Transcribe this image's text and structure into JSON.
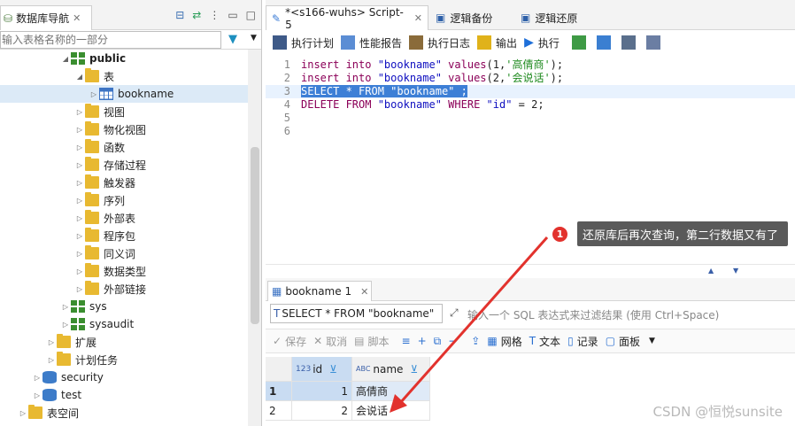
{
  "left_panel": {
    "tab_title": "数据库导航",
    "filter_placeholder": "输入表格名称的一部分",
    "tree": [
      {
        "label": "public",
        "level": 1,
        "icon": "schema",
        "bold": true
      },
      {
        "label": "表",
        "level": 2,
        "icon": "folder"
      },
      {
        "label": "bookname",
        "level": 3,
        "icon": "table",
        "selected": true
      },
      {
        "label": "视图",
        "level": 2,
        "icon": "folder"
      },
      {
        "label": "物化视图",
        "level": 2,
        "icon": "folder"
      },
      {
        "label": "函数",
        "level": 2,
        "icon": "folder"
      },
      {
        "label": "存储过程",
        "level": 2,
        "icon": "folder"
      },
      {
        "label": "触发器",
        "level": 2,
        "icon": "folder"
      },
      {
        "label": "序列",
        "level": 2,
        "icon": "folder"
      },
      {
        "label": "外部表",
        "level": 2,
        "icon": "folder"
      },
      {
        "label": "程序包",
        "level": 2,
        "icon": "folder"
      },
      {
        "label": "同义词",
        "level": 2,
        "icon": "folder"
      },
      {
        "label": "数据类型",
        "level": 2,
        "icon": "folder"
      },
      {
        "label": "外部链接",
        "level": 2,
        "icon": "folder"
      },
      {
        "label": "sys",
        "level": 1,
        "icon": "schema"
      },
      {
        "label": "sysaudit",
        "level": 1,
        "icon": "schema"
      },
      {
        "label": "扩展",
        "level": 0,
        "icon": "folder"
      },
      {
        "label": "计划任务",
        "level": 0,
        "icon": "folder"
      },
      {
        "label": "security",
        "level": -1,
        "icon": "db"
      },
      {
        "label": "test",
        "level": -1,
        "icon": "db"
      },
      {
        "label": "表空间",
        "level": -2,
        "icon": "folder"
      }
    ]
  },
  "editor": {
    "tabs": [
      {
        "label": "*<s166-wuhs> Script-5",
        "active": true
      },
      {
        "label": "逻辑备份"
      },
      {
        "label": "逻辑还原"
      }
    ],
    "toolbar": [
      "执行计划",
      "性能报告",
      "执行日志",
      "输出",
      "执行"
    ],
    "lines": [
      {
        "n": "1",
        "text": "insert into \"bookname\" values(1,'高倩商');"
      },
      {
        "n": "2",
        "text": "insert into \"bookname\" values(2,'会说话');"
      },
      {
        "n": "3",
        "text": "SELECT * FROM \"bookname\" ;"
      },
      {
        "n": "4",
        "text": "DELETE FROM \"bookname\" WHERE \"id\" = 2;"
      },
      {
        "n": "5",
        "text": ""
      },
      {
        "n": "6",
        "text": ""
      }
    ]
  },
  "results": {
    "tab_label": "bookname 1",
    "sql_filter": "SELECT * FROM \"bookname\"",
    "filter_hint": "输入一个 SQL 表达式来过滤结果 (使用 Ctrl+Space)",
    "toolbar": {
      "save": "保存",
      "cancel": "取消",
      "script": "脚本",
      "grid": "网格",
      "text": "文本",
      "record": "记录",
      "panel": "面板"
    },
    "columns": [
      {
        "type": "123",
        "name": "id"
      },
      {
        "type": "ABC",
        "name": "name"
      }
    ],
    "rows": [
      {
        "row": "1",
        "id": "1",
        "name": "高倩商"
      },
      {
        "row": "2",
        "id": "2",
        "name": "会说话"
      }
    ]
  },
  "annotation": {
    "badge": "1",
    "text": "还原库后再次查询，第二行数据又有了"
  },
  "watermark": "CSDN @恒悦sunsite"
}
